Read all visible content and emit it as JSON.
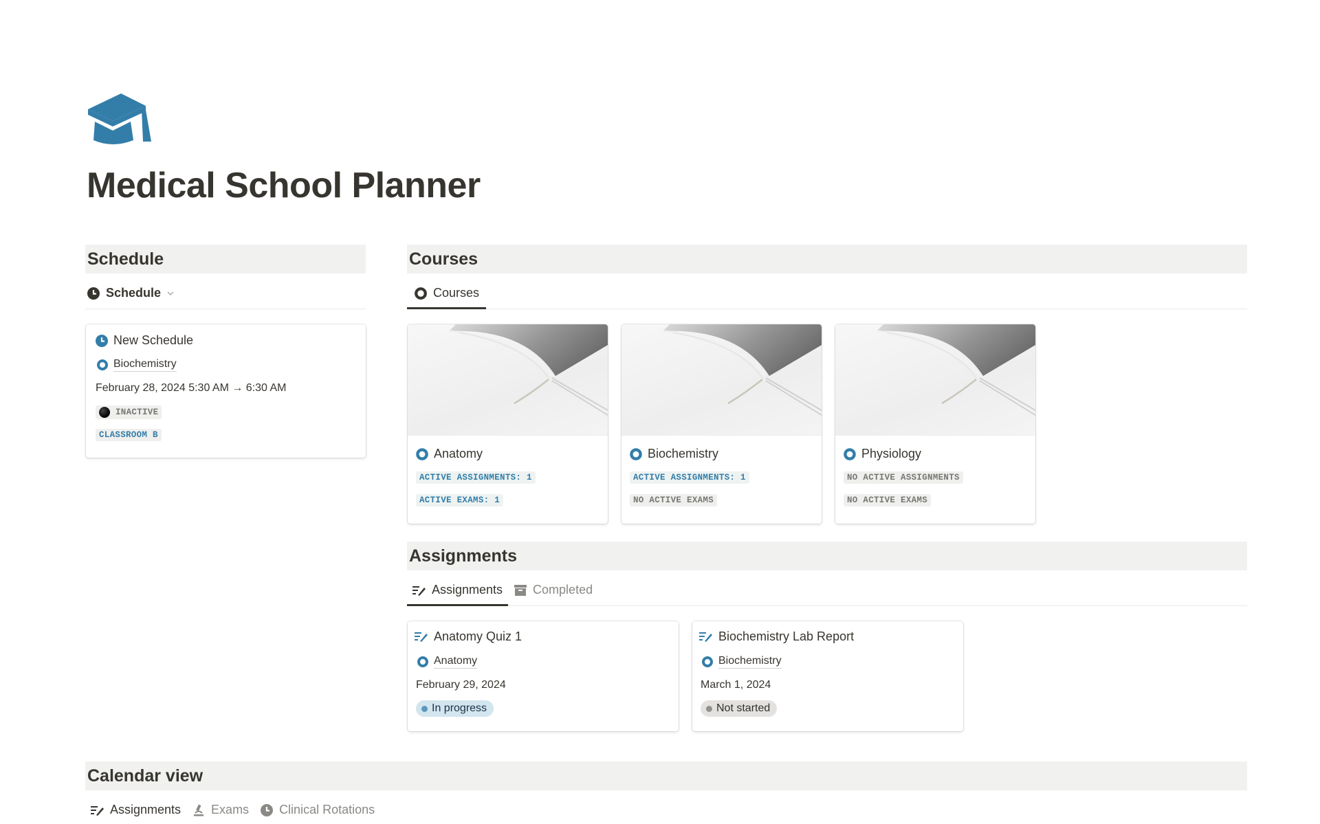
{
  "page": {
    "icon": "graduation-cap-icon",
    "title": "Medical School Planner",
    "accent_color": "#337ea9"
  },
  "schedule": {
    "header": "Schedule",
    "view_tab": {
      "label": "Schedule",
      "icon": "clock-icon"
    },
    "cards": [
      {
        "title": "New Schedule",
        "course": "Biochemistry",
        "datetime": "February 28, 2024 5:30 AM → 6:30 AM",
        "status_tag": "INACTIVE",
        "location_tag": "CLASSROOM B"
      }
    ]
  },
  "courses": {
    "header": "Courses",
    "view_tab": {
      "label": "Courses",
      "icon": "course-circle-icon"
    },
    "cards": [
      {
        "name": "Anatomy",
        "assignments_tag": "ACTIVE ASSIGNMENTS: 1",
        "assignments_active": true,
        "exams_tag": "ACTIVE EXAMS: 1",
        "exams_active": true
      },
      {
        "name": "Biochemistry",
        "assignments_tag": "ACTIVE ASSIGNMENTS: 1",
        "assignments_active": true,
        "exams_tag": "NO ACTIVE EXAMS",
        "exams_active": false
      },
      {
        "name": "Physiology",
        "assignments_tag": "NO ACTIVE ASSIGNMENTS",
        "assignments_active": false,
        "exams_tag": "NO ACTIVE EXAMS",
        "exams_active": false
      }
    ]
  },
  "assignments": {
    "header": "Assignments",
    "tabs": [
      {
        "label": "Assignments",
        "icon": "list-edit-icon",
        "active": true
      },
      {
        "label": "Completed",
        "icon": "archive-icon",
        "active": false
      }
    ],
    "cards": [
      {
        "title": "Anatomy Quiz 1",
        "course": "Anatomy",
        "date": "February 29, 2024",
        "status": "In progress",
        "status_color": "blue"
      },
      {
        "title": "Biochemistry Lab Report",
        "course": "Biochemistry",
        "date": "March 1, 2024",
        "status": "Not started",
        "status_color": "gray"
      }
    ]
  },
  "calendar": {
    "header": "Calendar view",
    "tabs": [
      {
        "label": "Assignments",
        "icon": "list-edit-icon",
        "active": true
      },
      {
        "label": "Exams",
        "icon": "microscope-icon",
        "active": false
      },
      {
        "label": "Clinical Rotations",
        "icon": "clock-icon",
        "active": false
      }
    ]
  }
}
